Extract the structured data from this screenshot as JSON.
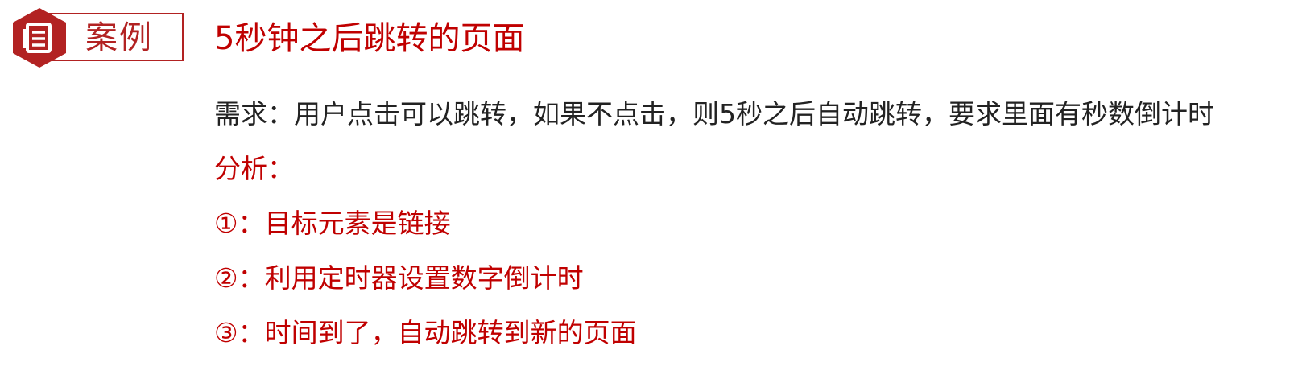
{
  "badge": {
    "label": "案例",
    "icon": "document-icon",
    "color": "#b22222"
  },
  "title": "5秒钟之后跳转的页面",
  "requirement": "需求：用户点击可以跳转，如果不点击，则5秒之后自动跳转，要求里面有秒数倒计时",
  "analysis": {
    "heading": "分析：",
    "steps": [
      "①：目标元素是链接",
      "②：利用定时器设置数字倒计时",
      "③：时间到了，自动跳转到新的页面"
    ]
  },
  "colors": {
    "accent": "#c00000",
    "text": "#222222"
  }
}
